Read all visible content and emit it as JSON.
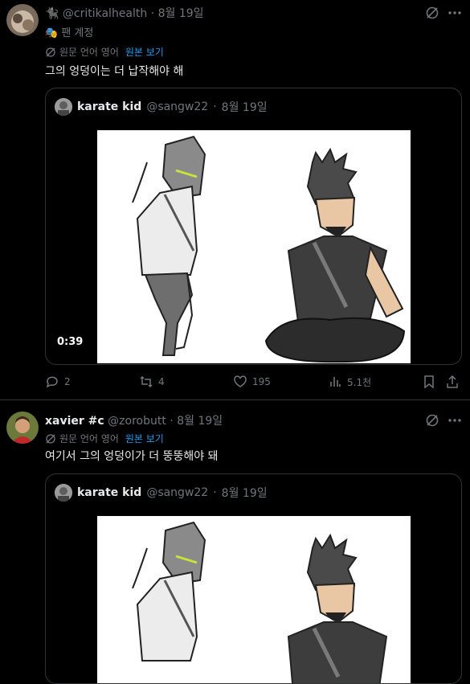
{
  "tweet1": {
    "handle": "@critikalhealth",
    "sep": "·",
    "date": "8월 19일",
    "badge": "팬 계정",
    "translate_label": "원문 언어 영어",
    "translate_link": "원본 보기",
    "text": "그의 엉덩이는 더 납작해야 해",
    "quote": {
      "name": "karate kid",
      "handle": "@sangw22",
      "sep": "·",
      "date": "8월 19일",
      "duration": "0:39"
    },
    "stats": {
      "replies": "2",
      "reposts": "4",
      "likes": "195",
      "views": "5.1천"
    }
  },
  "tweet2": {
    "name": "xavier #c",
    "handle": "@zorobutt",
    "sep": "·",
    "date": "8월 19일",
    "translate_label": "원문 언어 영어",
    "translate_link": "원본 보기",
    "text": "여기서 그의 엉덩이가 더 뚱뚱해야 돼",
    "quote": {
      "name": "karate kid",
      "handle": "@sangw22",
      "sep": "·",
      "date": "8월 19일"
    }
  },
  "colors": {
    "bg": "#000000",
    "text": "#e7e9ea",
    "muted": "#71767b",
    "link": "#1d9bf0",
    "border": "#2f3336"
  }
}
